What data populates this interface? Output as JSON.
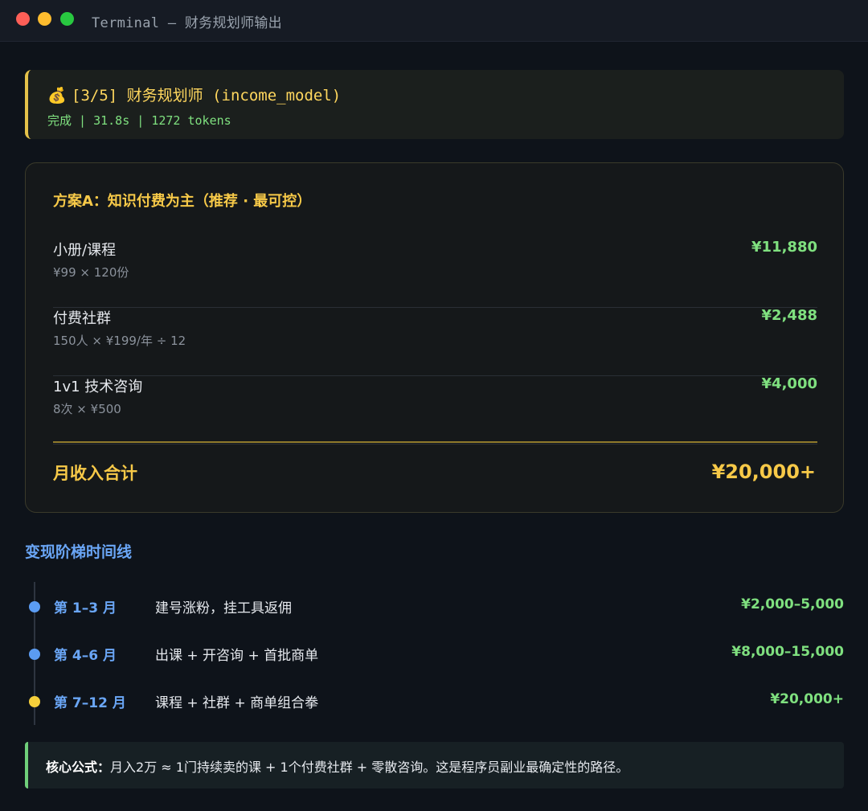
{
  "window": {
    "title": "Terminal — 财务规划师输出",
    "traffic_lights": [
      "close",
      "minimize",
      "maximize"
    ]
  },
  "agent": {
    "icon": "money-bag-icon",
    "icon_glyph": "💰",
    "title": "[3/5] 财务规划师 (income_model)",
    "meta": "完成 | 31.8s | 1272 tokens"
  },
  "plan": {
    "title": "方案A：知识付费为主（推荐 · 最可控）",
    "items": [
      {
        "name": "小册/课程",
        "desc": "¥99 × 120份",
        "value": "¥11,880"
      },
      {
        "name": "付费社群",
        "desc": "150人 × ¥199/年 ÷ 12",
        "value": "¥2,488"
      },
      {
        "name": "1v1 技术咨询",
        "desc": "8次 × ¥500",
        "value": "¥4,000"
      }
    ],
    "total_label": "月收入合计",
    "total_value": "¥20,000+"
  },
  "timeline": {
    "title": "变现阶梯时间线",
    "rows": [
      {
        "period": "第 1–3 月",
        "desc": "建号涨粉，挂工具返佣",
        "amount": "¥2,000–5,000",
        "dot_color": "#5b9cf2"
      },
      {
        "period": "第 4–6 月",
        "desc": "出课 + 开咨询 + 首批商单",
        "amount": "¥8,000–15,000",
        "dot_color": "#5b9cf2"
      },
      {
        "period": "第 7–12 月",
        "desc": "课程 + 社群 + 商单组合拳",
        "amount": "¥20,000+",
        "dot_color": "#f5cf3b"
      }
    ]
  },
  "formula": {
    "label": "核心公式：",
    "text": "月入2万 ≈ 1门持续卖的课 + 1个付费社群 + 零散咨询。这是程序员副业最确定性的路径。"
  },
  "colors": {
    "accent_yellow": "#f7c948",
    "accent_green": "#7fe07f",
    "accent_blue": "#6aa6f6",
    "background": "#0e131a"
  }
}
